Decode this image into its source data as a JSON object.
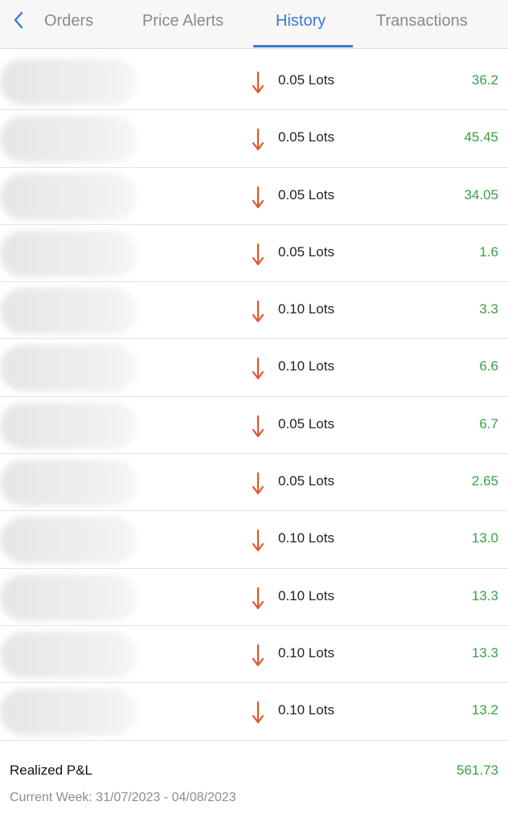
{
  "tabs": {
    "back_icon": "chevron-left-icon",
    "items": [
      "Orders",
      "Price Alerts",
      "History",
      "Transactions"
    ],
    "active": "History"
  },
  "colors": {
    "accent": "#3b78cf",
    "profit": "#3aa043",
    "sell_arrow": "#e2562b"
  },
  "history": [
    {
      "lots": "0.05 Lots",
      "pnl": "36.2",
      "direction": "down"
    },
    {
      "lots": "0.05 Lots",
      "pnl": "45.45",
      "direction": "down"
    },
    {
      "lots": "0.05 Lots",
      "pnl": "34.05",
      "direction": "down"
    },
    {
      "lots": "0.05 Lots",
      "pnl": "1.6",
      "direction": "down"
    },
    {
      "lots": "0.10 Lots",
      "pnl": "3.3",
      "direction": "down"
    },
    {
      "lots": "0.10 Lots",
      "pnl": "6.6",
      "direction": "down"
    },
    {
      "lots": "0.05 Lots",
      "pnl": "6.7",
      "direction": "down"
    },
    {
      "lots": "0.05 Lots",
      "pnl": "2.65",
      "direction": "down"
    },
    {
      "lots": "0.10 Lots",
      "pnl": "13.0",
      "direction": "down"
    },
    {
      "lots": "0.10 Lots",
      "pnl": "13.3",
      "direction": "down"
    },
    {
      "lots": "0.10 Lots",
      "pnl": "13.3",
      "direction": "down"
    },
    {
      "lots": "0.10 Lots",
      "pnl": "13.2",
      "direction": "down"
    }
  ],
  "summary": {
    "realized_label": "Realized P&L",
    "realized_value": "561.73",
    "period": "Current Week: 31/07/2023 - 04/08/2023"
  }
}
